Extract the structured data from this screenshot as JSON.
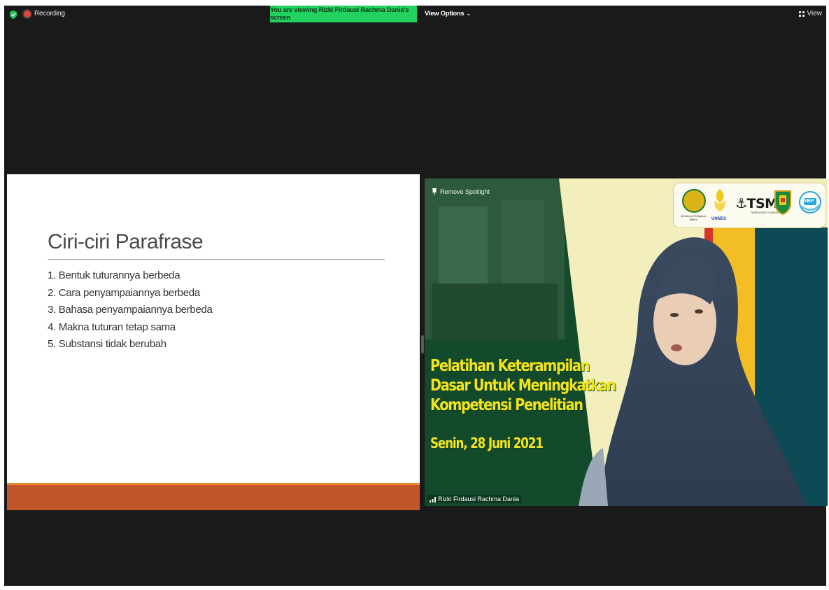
{
  "topbar": {
    "recording_label": "Recording",
    "viewing_banner": "You are viewing Rizki Firdausi Rachma Dania's screen",
    "view_options_label": "View Options",
    "view_options_chevron": "⌄",
    "view_label": "View"
  },
  "slide": {
    "title": "Ciri-ciri Parafrase",
    "items": [
      "1. Bentuk tuturannya berbeda",
      "2. Cara penyampaiannya berbeda",
      "3. Bahasa penyampaiannya berbeda",
      "4. Makna tuturan tetap sama",
      "5. Substansi tidak berubah"
    ]
  },
  "video": {
    "remove_spotlight_label": "Remove Spotlight",
    "headline_lines": [
      "Pelatihan Keterampilan",
      "Dasar Untuk Meningkatkan",
      "Kompetensi Penelitian"
    ],
    "date": "Senin, 28 Juni 2021",
    "participant_name": "Rizki Firdausi Rachma Dania",
    "logos": {
      "logo1_caption": "Ministry of Religious Affairs",
      "logo2_caption": "UNNES",
      "logo3_text": "⚓TSM",
      "logo3_caption": "TARBIYAHSOC MANAGEMENT",
      "logo5_text": "SBP"
    }
  },
  "colors": {
    "banner_green": "#23d160",
    "slide_footer": "#c0562a",
    "video_green": "#124a2b",
    "headline_yellow": "#f2e41c",
    "stripe_red": "#d8352a",
    "stripe_yellow": "#f2be23",
    "stripe_teal": "#0e4a56",
    "cream": "#f2efbd"
  },
  "icons": [
    "shield-icon",
    "recording-icon",
    "grid-icon",
    "pin-icon",
    "signal-icon"
  ]
}
